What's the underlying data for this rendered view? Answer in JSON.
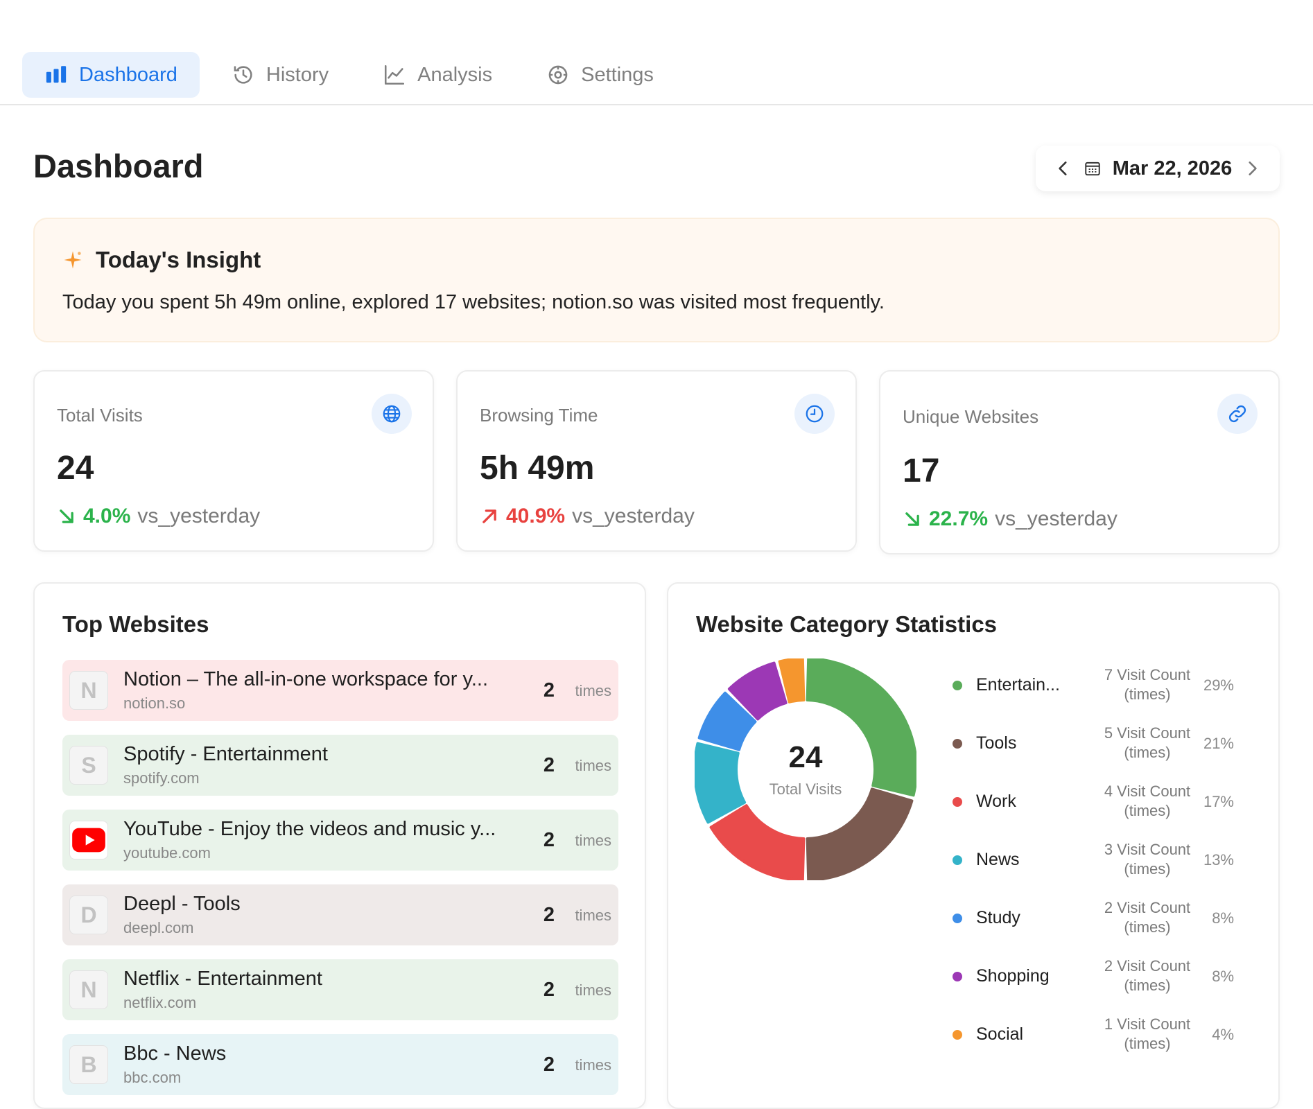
{
  "tabs": [
    {
      "label": "Dashboard",
      "icon": "bar-chart-icon",
      "active": true
    },
    {
      "label": "History",
      "icon": "history-icon",
      "active": false
    },
    {
      "label": "Analysis",
      "icon": "trend-icon",
      "active": false
    },
    {
      "label": "Settings",
      "icon": "gear-icon",
      "active": false
    }
  ],
  "page": {
    "title": "Dashboard"
  },
  "date_nav": {
    "date": "Mar 22, 2026"
  },
  "insight": {
    "title": "Today's Insight",
    "text": "Today you spent 5h 49m online, explored 17 websites; notion.so was visited most frequently."
  },
  "stats": [
    {
      "label": "Total Visits",
      "value": "24",
      "change": "4.0%",
      "direction": "down",
      "vs": "vs_yesterday",
      "icon": "globe-icon"
    },
    {
      "label": "Browsing Time",
      "value": "5h 49m",
      "change": "40.9%",
      "direction": "up",
      "vs": "vs_yesterday",
      "icon": "clock-icon"
    },
    {
      "label": "Unique Websites",
      "value": "17",
      "change": "22.7%",
      "direction": "down",
      "vs": "vs_yesterday",
      "icon": "link-icon"
    }
  ],
  "top_websites": {
    "title": "Top Websites",
    "unit": "times",
    "items": [
      {
        "letter": "N",
        "name": "Notion – The all-in-one workspace for y...",
        "domain": "notion.so",
        "count": "2",
        "bg": "#fde7e8"
      },
      {
        "letter": "S",
        "name": "Spotify - Entertainment",
        "domain": "spotify.com",
        "count": "2",
        "bg": "#e9f3ea"
      },
      {
        "letter": "",
        "name": "YouTube - Enjoy the videos and music y...",
        "domain": "youtube.com",
        "count": "2",
        "bg": "#e9f3ea",
        "icon": "youtube-icon"
      },
      {
        "letter": "D",
        "name": "Deepl - Tools",
        "domain": "deepl.com",
        "count": "2",
        "bg": "#efeae9"
      },
      {
        "letter": "N",
        "name": "Netflix - Entertainment",
        "domain": "netflix.com",
        "count": "2",
        "bg": "#e9f3ea"
      },
      {
        "letter": "B",
        "name": "Bbc - News",
        "domain": "bbc.com",
        "count": "2",
        "bg": "#e7f4f6"
      }
    ]
  },
  "category_stats": {
    "title": "Website Category Statistics",
    "center_value": "24",
    "center_label": "Total Visits"
  },
  "chart_data": {
    "type": "pie",
    "title": "Website Category Statistics",
    "total": 24,
    "categories": [
      "Entertain...",
      "Tools",
      "Work",
      "News",
      "Study",
      "Shopping",
      "Social"
    ],
    "values": [
      7,
      5,
      4,
      3,
      2,
      2,
      1
    ],
    "count_labels": [
      "7 Visit Count (times)",
      "5 Visit Count (times)",
      "4 Visit Count (times)",
      "3 Visit Count (times)",
      "2 Visit Count (times)",
      "2 Visit Count (times)",
      "1 Visit Count (times)"
    ],
    "percents": [
      "29%",
      "21%",
      "17%",
      "13%",
      "8%",
      "8%",
      "4%"
    ],
    "colors": [
      "#5aac5a",
      "#7b5a50",
      "#e94b4b",
      "#34b3c9",
      "#3e8ee8",
      "#9c38b5",
      "#f5962e"
    ],
    "legend_position": "right"
  }
}
